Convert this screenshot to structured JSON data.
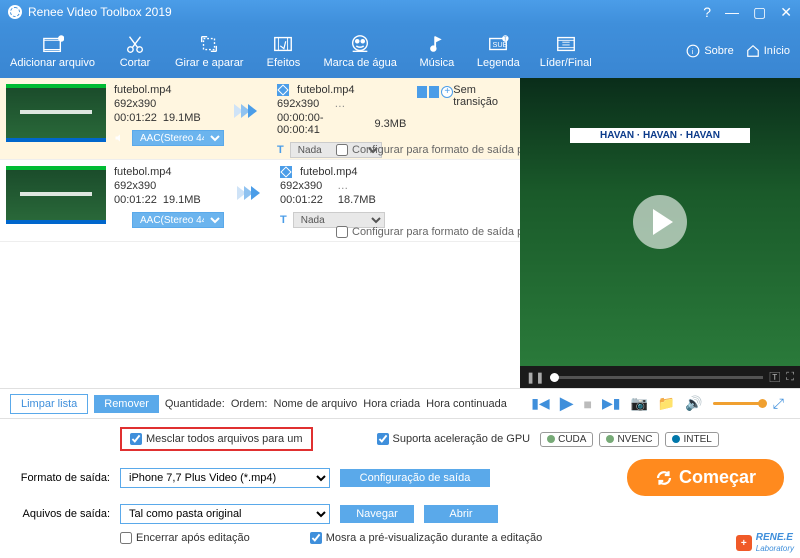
{
  "window": {
    "title": "Renee Video Toolbox 2019"
  },
  "toolbar": {
    "items": [
      {
        "label": "Adicionar arquivo"
      },
      {
        "label": "Cortar"
      },
      {
        "label": "Girar e aparar"
      },
      {
        "label": "Efeitos"
      },
      {
        "label": "Marca de água"
      },
      {
        "label": "Música"
      },
      {
        "label": "Legenda"
      },
      {
        "label": "Líder/Final"
      }
    ],
    "about": "Sobre",
    "home": "Início"
  },
  "files": [
    {
      "src_name": "futebol.mp4",
      "src_res": "692x390",
      "src_dur": "00:01:22",
      "src_size": "19.1MB",
      "audio_sel": "AAC(Stereo 44…",
      "sub_sel": "Nada",
      "out_name": "futebol.mp4",
      "out_res": "692x390",
      "out_dur": "00:00:00-00:00:41",
      "out_size": "9.3MB",
      "trans": "Sem transição",
      "more": "…",
      "cfg": "Configurar para formato de saída pad"
    },
    {
      "src_name": "futebol.mp4",
      "src_res": "692x390",
      "src_dur": "00:01:22",
      "src_size": "19.1MB",
      "audio_sel": "AAC(Stereo 44…",
      "sub_sel": "Nada",
      "out_name": "futebol.mp4",
      "out_res": "692x390",
      "out_dur": "00:01:22",
      "out_size": "18.7MB",
      "more": "…",
      "cfg": "Configurar para formato de saída pad"
    }
  ],
  "preview": {
    "ad": "HAVAN · HAVAN · HAVAN",
    "pause_icon": "❚❚",
    "fs_icon": "⛶",
    "tc_icon": "🅃"
  },
  "listbar": {
    "clear": "Limpar lista",
    "remove": "Remover",
    "qty_label": "Quantidade:",
    "order_label": "Ordem:",
    "order_name": "Nome de arquivo",
    "order_time": "Hora criada",
    "order_cont": "Hora continuada"
  },
  "player": {
    "prev": "▮◀",
    "play": "▶",
    "stop": "■",
    "next": "▶▮",
    "capture": "📷",
    "folder": "📁",
    "vol": "🔊",
    "fs": "⤢"
  },
  "options": {
    "merge": "Mesclar todos arquivos para um",
    "gpu_support": "Suporta aceleração de GPU",
    "cuda": "CUDA",
    "nvenc": "NVENC",
    "intel": "INTEL",
    "out_format_label": "Formato de saída:",
    "out_format_value": "iPhone 7,7 Plus Video (*.mp4)",
    "out_path_label": "Aquivos de saída:",
    "out_path_value": "Tal como pasta original",
    "config": "Configuração de saída",
    "browse": "Navegar",
    "open": "Abrir",
    "shutdown": "Encerrar após editação",
    "preview_on_edit": "Mosra a pré-visualização durante a editação",
    "start": "Começar"
  },
  "brand": {
    "text": "RENE.E",
    "sub": "Laboratory"
  }
}
